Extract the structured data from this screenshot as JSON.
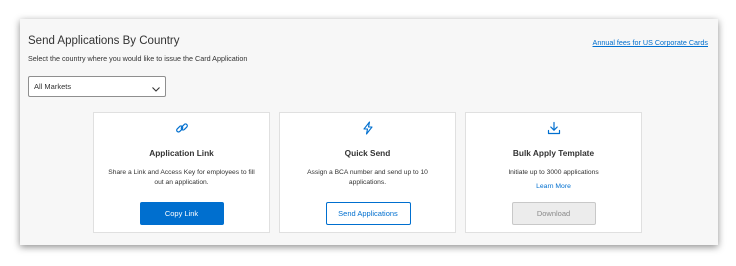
{
  "header": {
    "title": "Send Applications By Country",
    "subtitle": "Select the country where you would like to issue the Card Application",
    "fees_link": "Annual fees for US Corporate Cards"
  },
  "market_select": {
    "selected": "All Markets",
    "icon": "chevron-down-icon"
  },
  "cards": [
    {
      "icon": "link-icon",
      "title": "Application Link",
      "description": "Share a Link and Access Key for employees to fill out an application.",
      "button_label": "Copy Link"
    },
    {
      "icon": "lightning-icon",
      "title": "Quick Send",
      "description": "Assign a BCA number and send up to 10 applications.",
      "button_label": "Send Applications"
    },
    {
      "icon": "download-icon",
      "title": "Bulk Apply Template",
      "description": "Initiate up to 3000 applications",
      "link_label": "Learn More",
      "button_label": "Download"
    }
  ],
  "colors": {
    "accent": "#006fcf",
    "text": "#333333",
    "panel_background": "#f7f7f7",
    "disabled_background": "#ececec"
  }
}
